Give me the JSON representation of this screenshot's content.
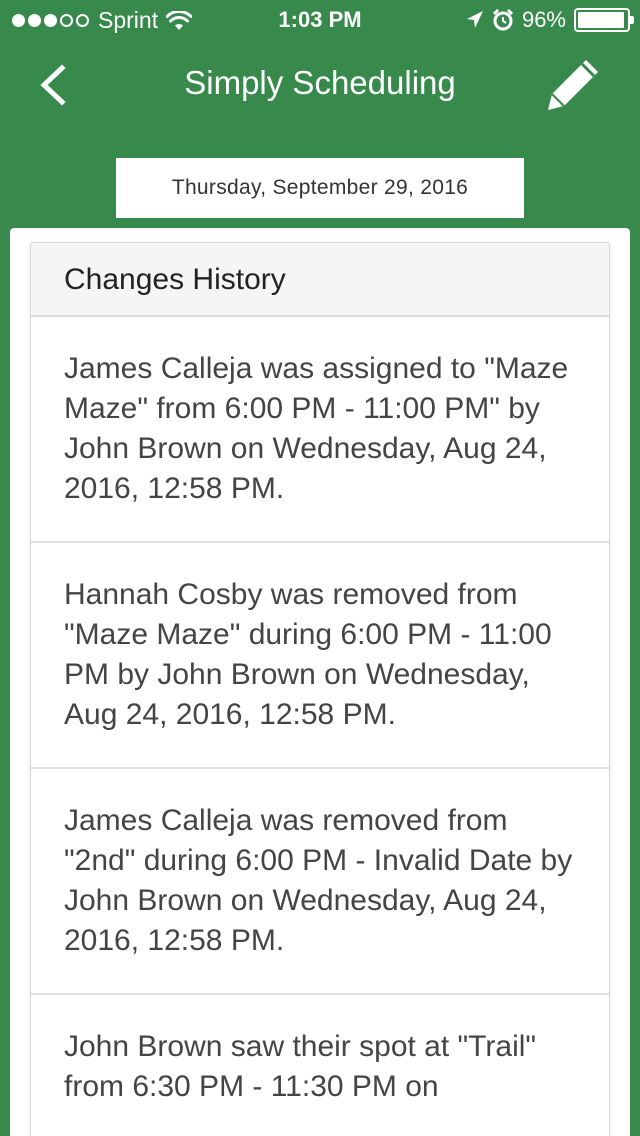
{
  "status_bar": {
    "carrier": "Sprint",
    "time": "1:03 PM",
    "battery": "96%",
    "battery_level": 0.96,
    "signal_bars_filled": 3,
    "signal_bars_total": 5
  },
  "nav": {
    "title": "Simply Scheduling",
    "back_icon": "chevron-left-icon",
    "edit_icon": "pencil-icon"
  },
  "date": "Thursday, September 29, 2016",
  "history": {
    "title": "Changes History",
    "items": [
      {
        "text": "James Calleja was assigned to \"Maze Maze\" from 6:00 PM - 11:00 PM\" by John Brown on Wednesday, Aug 24, 2016, 12:58 PM."
      },
      {
        "text": "Hannah Cosby was removed from \"Maze Maze\" during 6:00 PM - 11:00 PM by John Brown on Wednesday, Aug 24, 2016, 12:58 PM."
      },
      {
        "text": "James Calleja was removed from \"2nd\" during 6:00 PM - Invalid Date by John Brown on Wednesday, Aug 24, 2016, 12:58 PM."
      },
      {
        "text": "John Brown saw their spot at \"Trail\" from 6:30 PM - 11:30 PM on"
      }
    ]
  },
  "colors": {
    "brand_green": "#388a4c",
    "header_bg": "#f5f5f5"
  }
}
